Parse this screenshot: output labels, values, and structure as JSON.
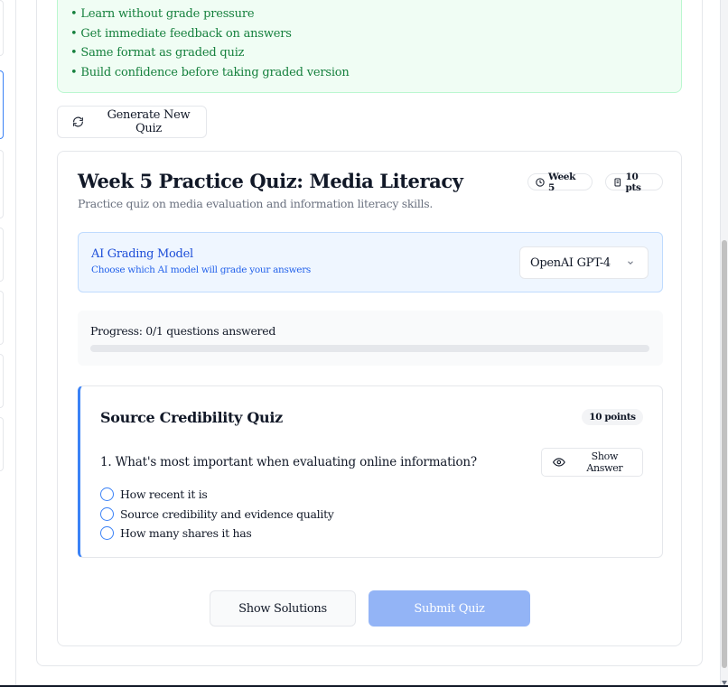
{
  "info_box": {
    "bullets": [
      "• Learn without grade pressure",
      "• Get immediate feedback on answers",
      "• Same format as graded quiz",
      "• Build confidence before taking graded version"
    ]
  },
  "generate_button": {
    "label": "Generate New Quiz",
    "icon": "refresh-icon"
  },
  "quiz": {
    "title": "Week 5 Practice Quiz: Media Literacy",
    "description": "Practice quiz on media evaluation and information literacy skills.",
    "week_badge": "Week 5",
    "points_badge": "10 pts"
  },
  "grading_model": {
    "label": "AI Grading Model",
    "help": "Choose which AI model will grade your answers",
    "selected": "OpenAI GPT-4"
  },
  "progress": {
    "text": "Progress: 0/1 questions answered",
    "fraction": 0
  },
  "question_section": {
    "title": "Source Credibility Quiz",
    "points": "10 points",
    "question": "1. What's most important when evaluating online information?",
    "show_answer_label": "Show Answer",
    "options": [
      "How recent it is",
      "Source credibility and evidence quality",
      "How many shares it has"
    ]
  },
  "actions": {
    "show_solutions": "Show Solutions",
    "submit": "Submit Quiz"
  },
  "colors": {
    "accent": "#3b82f6",
    "success_text": "#15803d",
    "submit_disabled": "#93b4f6"
  }
}
